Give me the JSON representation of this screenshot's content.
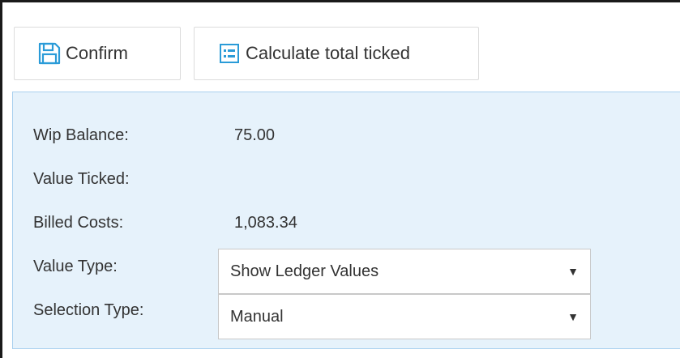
{
  "toolbar": {
    "confirm_label": "Confirm",
    "calculate_label": "Calculate total ticked"
  },
  "colors": {
    "panel_background": "#e6f2fb",
    "panel_border": "#a9d0ef",
    "icon_blue": "#2a9bd8"
  },
  "icons": {
    "confirm": "floppy-disk-icon",
    "calculate": "calculator-icon",
    "dropdown": "caret-down-icon"
  },
  "summary": {
    "wip_balance_label": "Wip Balance:",
    "wip_balance_value": "75.00",
    "value_ticked_label": "Value Ticked:",
    "value_ticked_value": "",
    "billed_costs_label": "Billed Costs:",
    "billed_costs_value": "1,083.34",
    "value_type_label": "Value Type:",
    "value_type_selected": "Show Ledger Values",
    "selection_type_label": "Selection Type:",
    "selection_type_selected": "Manual",
    "caret": "▼"
  }
}
